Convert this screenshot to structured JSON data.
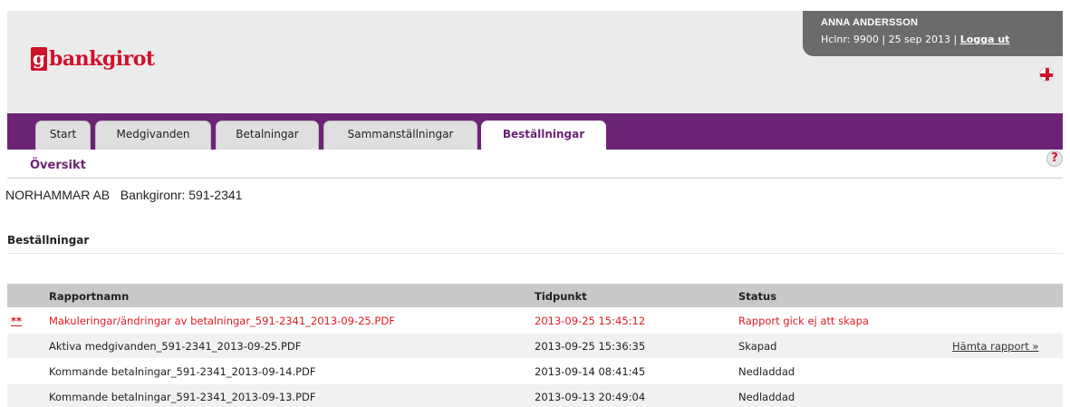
{
  "header": {
    "logo_mark": "g",
    "logo_text": "bankgirot",
    "user_name": "ANNA ANDERSSON",
    "user_info": "Hclnr: 9900 | 25 sep 2013 |",
    "logout_label": "Logga ut",
    "flag_icon": "uk-flag-icon"
  },
  "nav": {
    "tabs": [
      {
        "label": "Start"
      },
      {
        "label": "Medgivanden"
      },
      {
        "label": "Betalningar"
      },
      {
        "label": "Sammanställningar"
      },
      {
        "label": "Beställningar",
        "active": true
      }
    ]
  },
  "subnav": {
    "overview_label": "Översikt",
    "help_label": "?"
  },
  "company": {
    "text": "NORHAMMAR AB   Bankgironr: 591-2341"
  },
  "section": {
    "title": "Beställningar"
  },
  "table": {
    "headers": {
      "name": "Rapportnamn",
      "time": "Tidpunkt",
      "status": "Status"
    },
    "rows": [
      {
        "mark": "**",
        "name": "Makuleringar/ändringar av betalningar_591-2341_2013-09-25.PDF",
        "time": "2013-09-25 15:45:12",
        "status": "Rapport gick ej att skapa",
        "action": "",
        "error": true
      },
      {
        "mark": "",
        "name": "Aktiva medgivanden_591-2341_2013-09-25.PDF",
        "time": "2013-09-25 15:36:35",
        "status": "Skapad",
        "action": "Hämta rapport »",
        "error": false
      },
      {
        "mark": "",
        "name": "Kommande betalningar_591-2341_2013-09-14.PDF",
        "time": "2013-09-14 08:41:45",
        "status": "Nedladdad",
        "action": "",
        "error": false
      },
      {
        "mark": "",
        "name": "Kommande betalningar_591-2341_2013-09-13.PDF",
        "time": "2013-09-13 20:49:04",
        "status": "Nedladdad",
        "action": "",
        "error": false
      }
    ]
  },
  "colors": {
    "brand_red": "#d0112b",
    "nav_purple": "#6c2375",
    "error_red": "#e01c23"
  }
}
